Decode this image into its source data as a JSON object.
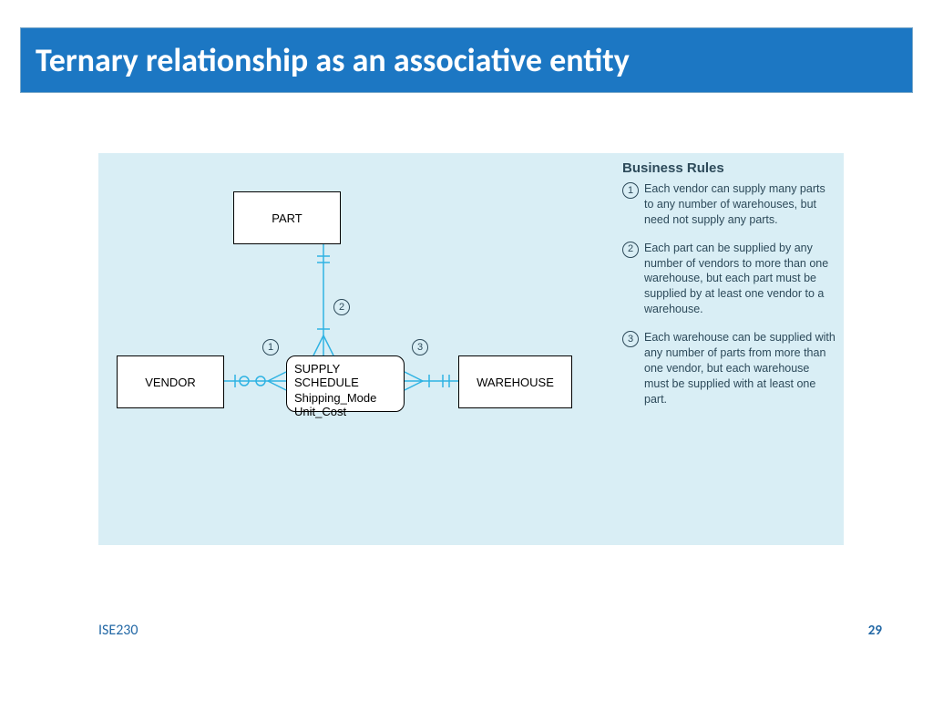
{
  "slide": {
    "title": "Ternary relationship as an associative entity",
    "course": "ISE230",
    "page": "29"
  },
  "diagram": {
    "entities": {
      "part": "PART",
      "vendor": "VENDOR",
      "warehouse": "WAREHOUSE"
    },
    "associative": {
      "title": "SUPPLY SCHEDULE",
      "attr1": "Shipping_Mode",
      "attr2": "Unit_Cost"
    },
    "badges": {
      "b1": "1",
      "b2": "2",
      "b3": "3"
    }
  },
  "rules": {
    "heading": "Business Rules",
    "items": [
      {
        "num": "1",
        "text": "Each vendor can supply many parts to any number of warehouses, but need not supply any parts."
      },
      {
        "num": "2",
        "text": "Each part can be supplied by any number of vendors to more than one warehouse, but each part must be supplied by at least one vendor to a warehouse."
      },
      {
        "num": "3",
        "text": "Each warehouse can be supplied with any number of parts from more than one vendor, but each warehouse must be supplied with at least one part."
      }
    ]
  }
}
